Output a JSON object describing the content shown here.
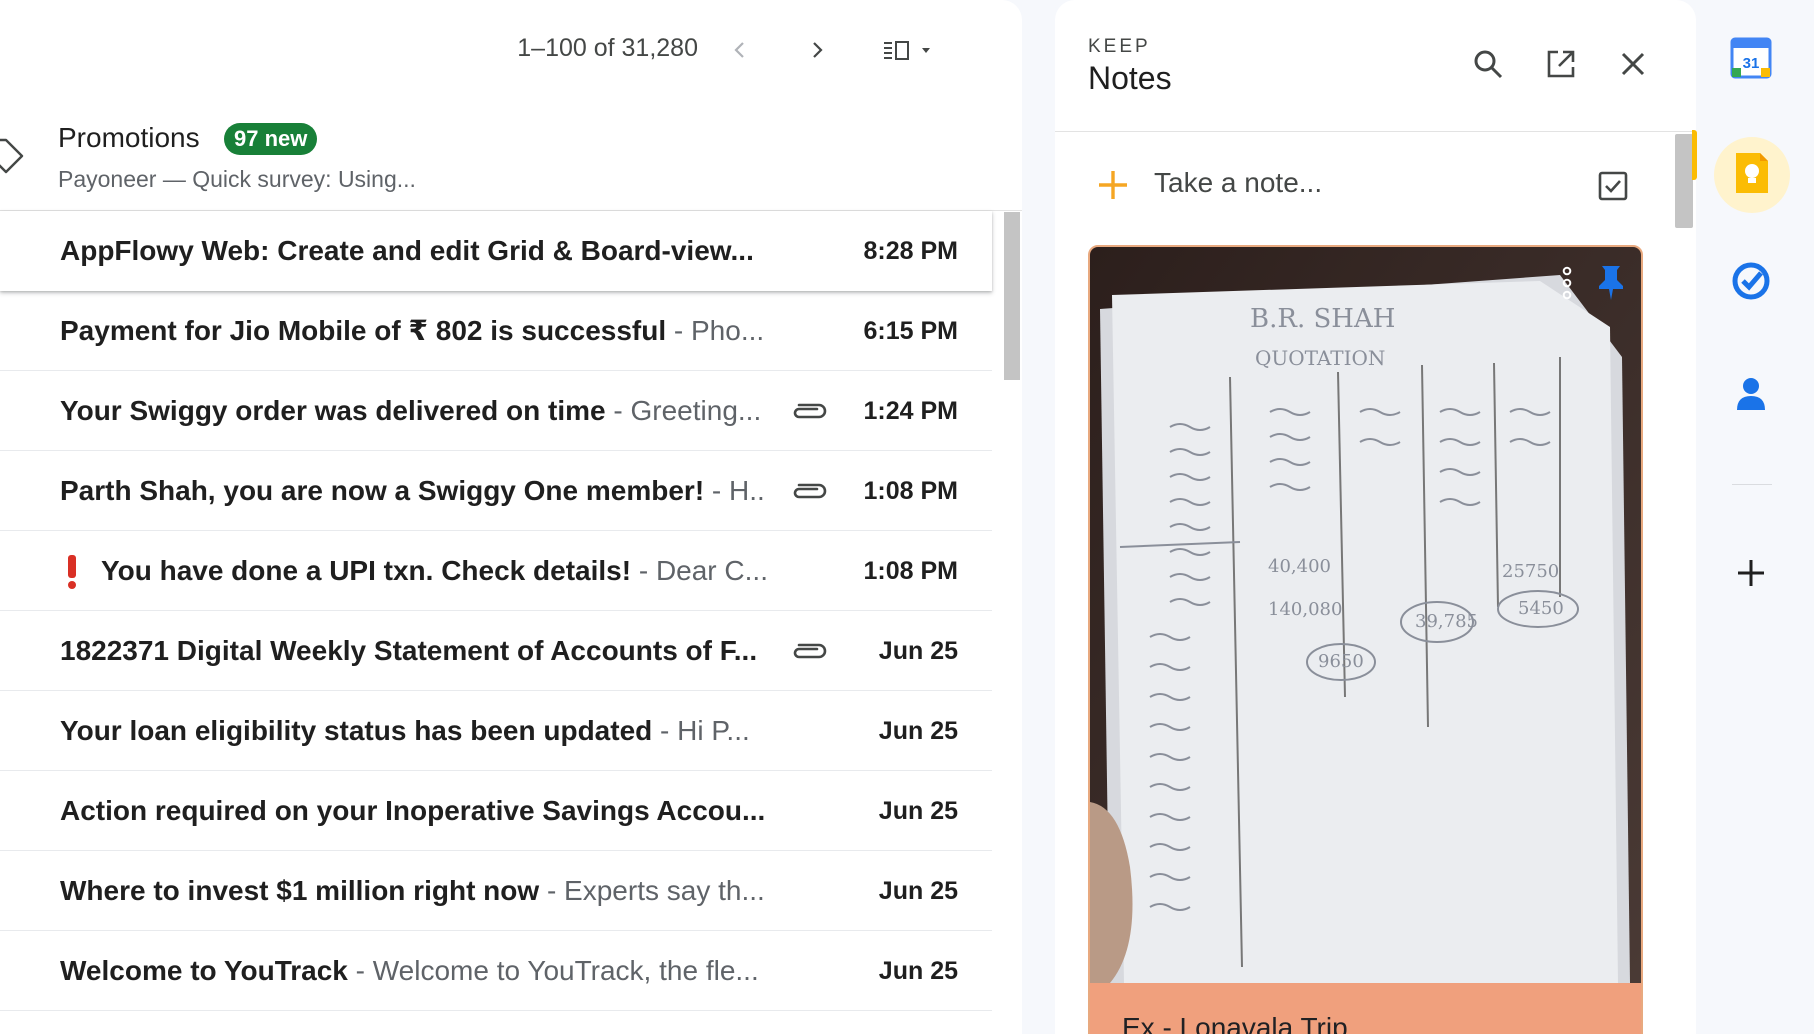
{
  "toolbar": {
    "pagination": "1–100 of 31,280",
    "prev_icon": "chevron-left-icon",
    "next_icon": "chevron-right-icon",
    "split_pane_icon": "split-pane-icon"
  },
  "promotions": {
    "title": "Promotions",
    "badge": "97 new",
    "preview": "Payoneer — Quick survey: Using...",
    "badge_color": "#188038"
  },
  "emails": [
    {
      "subject": "AppFlowy Web: Create and edit Grid & Board-view...",
      "snippet": "",
      "date": "8:28 PM",
      "attachment": false,
      "important": false
    },
    {
      "subject": "Payment for Jio Mobile of ₹ 802 is successful",
      "snippet": " - Pho...",
      "date": "6:15 PM",
      "attachment": false,
      "important": false
    },
    {
      "subject": "Your Swiggy order was delivered on time",
      "snippet": " - Greeting...",
      "date": "1:24 PM",
      "attachment": true,
      "important": false
    },
    {
      "subject": "Parth Shah, you are now a Swiggy One member!",
      "snippet": " - H..",
      "date": "1:08 PM",
      "attachment": true,
      "important": false
    },
    {
      "subject": "You have done a UPI txn. Check details!",
      "snippet": " - Dear C...",
      "date": "1:08 PM",
      "attachment": false,
      "important": true
    },
    {
      "subject": "1822371 Digital Weekly Statement of Accounts of F...",
      "snippet": "",
      "date": "Jun 25",
      "attachment": true,
      "important": false
    },
    {
      "subject": "Your loan eligibility status has been updated",
      "snippet": " - Hi P...",
      "date": "Jun 25",
      "attachment": false,
      "important": false
    },
    {
      "subject": "Action required on your Inoperative Savings Accou...",
      "snippet": "",
      "date": "Jun 25",
      "attachment": false,
      "important": false
    },
    {
      "subject": "Where to invest $1 million right now",
      "snippet": " - Experts say th...",
      "date": "Jun 25",
      "attachment": false,
      "important": false
    },
    {
      "subject": "Welcome to YouTrack",
      "snippet": " - Welcome to YouTrack, the fle...",
      "date": "Jun 25",
      "attachment": false,
      "important": false
    }
  ],
  "keep": {
    "eyebrow": "KEEP",
    "title": "Notes",
    "take_note_placeholder": "Take a note...",
    "note": {
      "title": "Ex - Lonavala Trip",
      "color": "#f0a07d",
      "photo_texts": [
        "B.R. SHAH",
        "QUOTATION",
        "40,400",
        "140,080",
        "39,785",
        "25750",
        "5450",
        "9650"
      ]
    }
  },
  "rail": {
    "items": [
      "calendar-icon",
      "keep-icon",
      "tasks-icon",
      "contacts-icon"
    ],
    "calendar_day": "31",
    "add_label": "+"
  },
  "colors": {
    "accent_keep": "#fbbc04",
    "important_red": "#d93025",
    "tasks_blue": "#1a73e8"
  }
}
